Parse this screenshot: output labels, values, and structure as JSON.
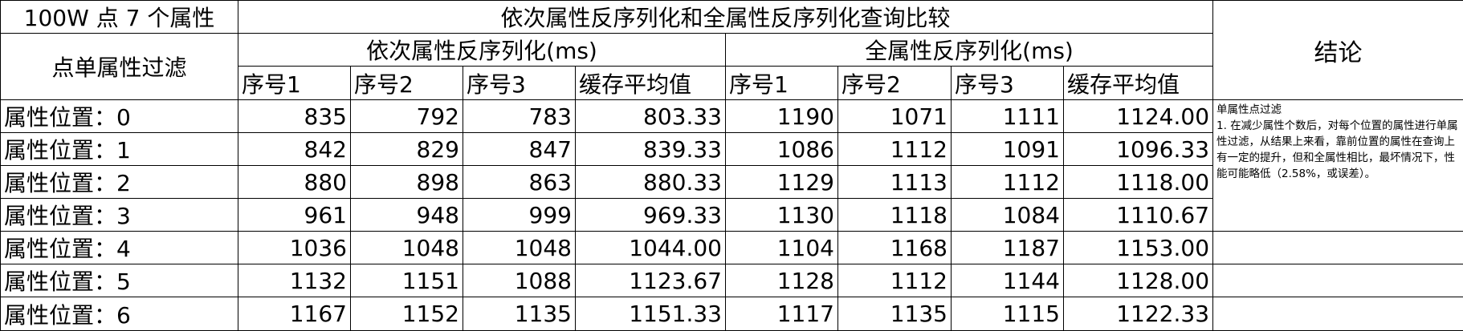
{
  "sheet": {
    "top_left": "100W 点 7 个属性",
    "group_title": "依次属性反序列化和全属性反序列化查询比较",
    "conclusion_header": "结论",
    "row_header": "点单属性过滤",
    "sub_left": "依次属性反序列化(ms)",
    "sub_right": "全属性反序列化(ms)",
    "columns": [
      "序号1",
      "序号2",
      "序号3",
      "缓存平均值",
      "序号1",
      "序号2",
      "序号3",
      "缓存平均值"
    ],
    "rows": [
      {
        "label": "属性位置：0",
        "values": [
          "835",
          "792",
          "783",
          "803.33",
          "1190",
          "1071",
          "1111",
          "1124.00"
        ]
      },
      {
        "label": "属性位置：1",
        "values": [
          "842",
          "829",
          "847",
          "839.33",
          "1086",
          "1112",
          "1091",
          "1096.33"
        ]
      },
      {
        "label": "属性位置：2",
        "values": [
          "880",
          "898",
          "863",
          "880.33",
          "1129",
          "1113",
          "1112",
          "1118.00"
        ]
      },
      {
        "label": "属性位置：3",
        "values": [
          "961",
          "948",
          "999",
          "969.33",
          "1130",
          "1118",
          "1084",
          "1110.67"
        ]
      },
      {
        "label": "属性位置：4",
        "values": [
          "1036",
          "1048",
          "1048",
          "1044.00",
          "1104",
          "1168",
          "1187",
          "1153.00"
        ]
      },
      {
        "label": "属性位置：5",
        "values": [
          "1132",
          "1151",
          "1088",
          "1123.67",
          "1128",
          "1112",
          "1144",
          "1128.00"
        ]
      },
      {
        "label": "属性位置：6",
        "values": [
          "1167",
          "1152",
          "1135",
          "1151.33",
          "1117",
          "1135",
          "1115",
          "1122.33"
        ]
      }
    ],
    "conclusion_title": "单属性点过滤",
    "conclusion_text": "1. 在减少属性个数后，对每个位置的属性进行单属性过滤，从结果上来看，靠前位置的属性在查询上有一定的提升，但和全属性相比，最坏情况下，性能可能略低（2.58%，或误差）。"
  }
}
